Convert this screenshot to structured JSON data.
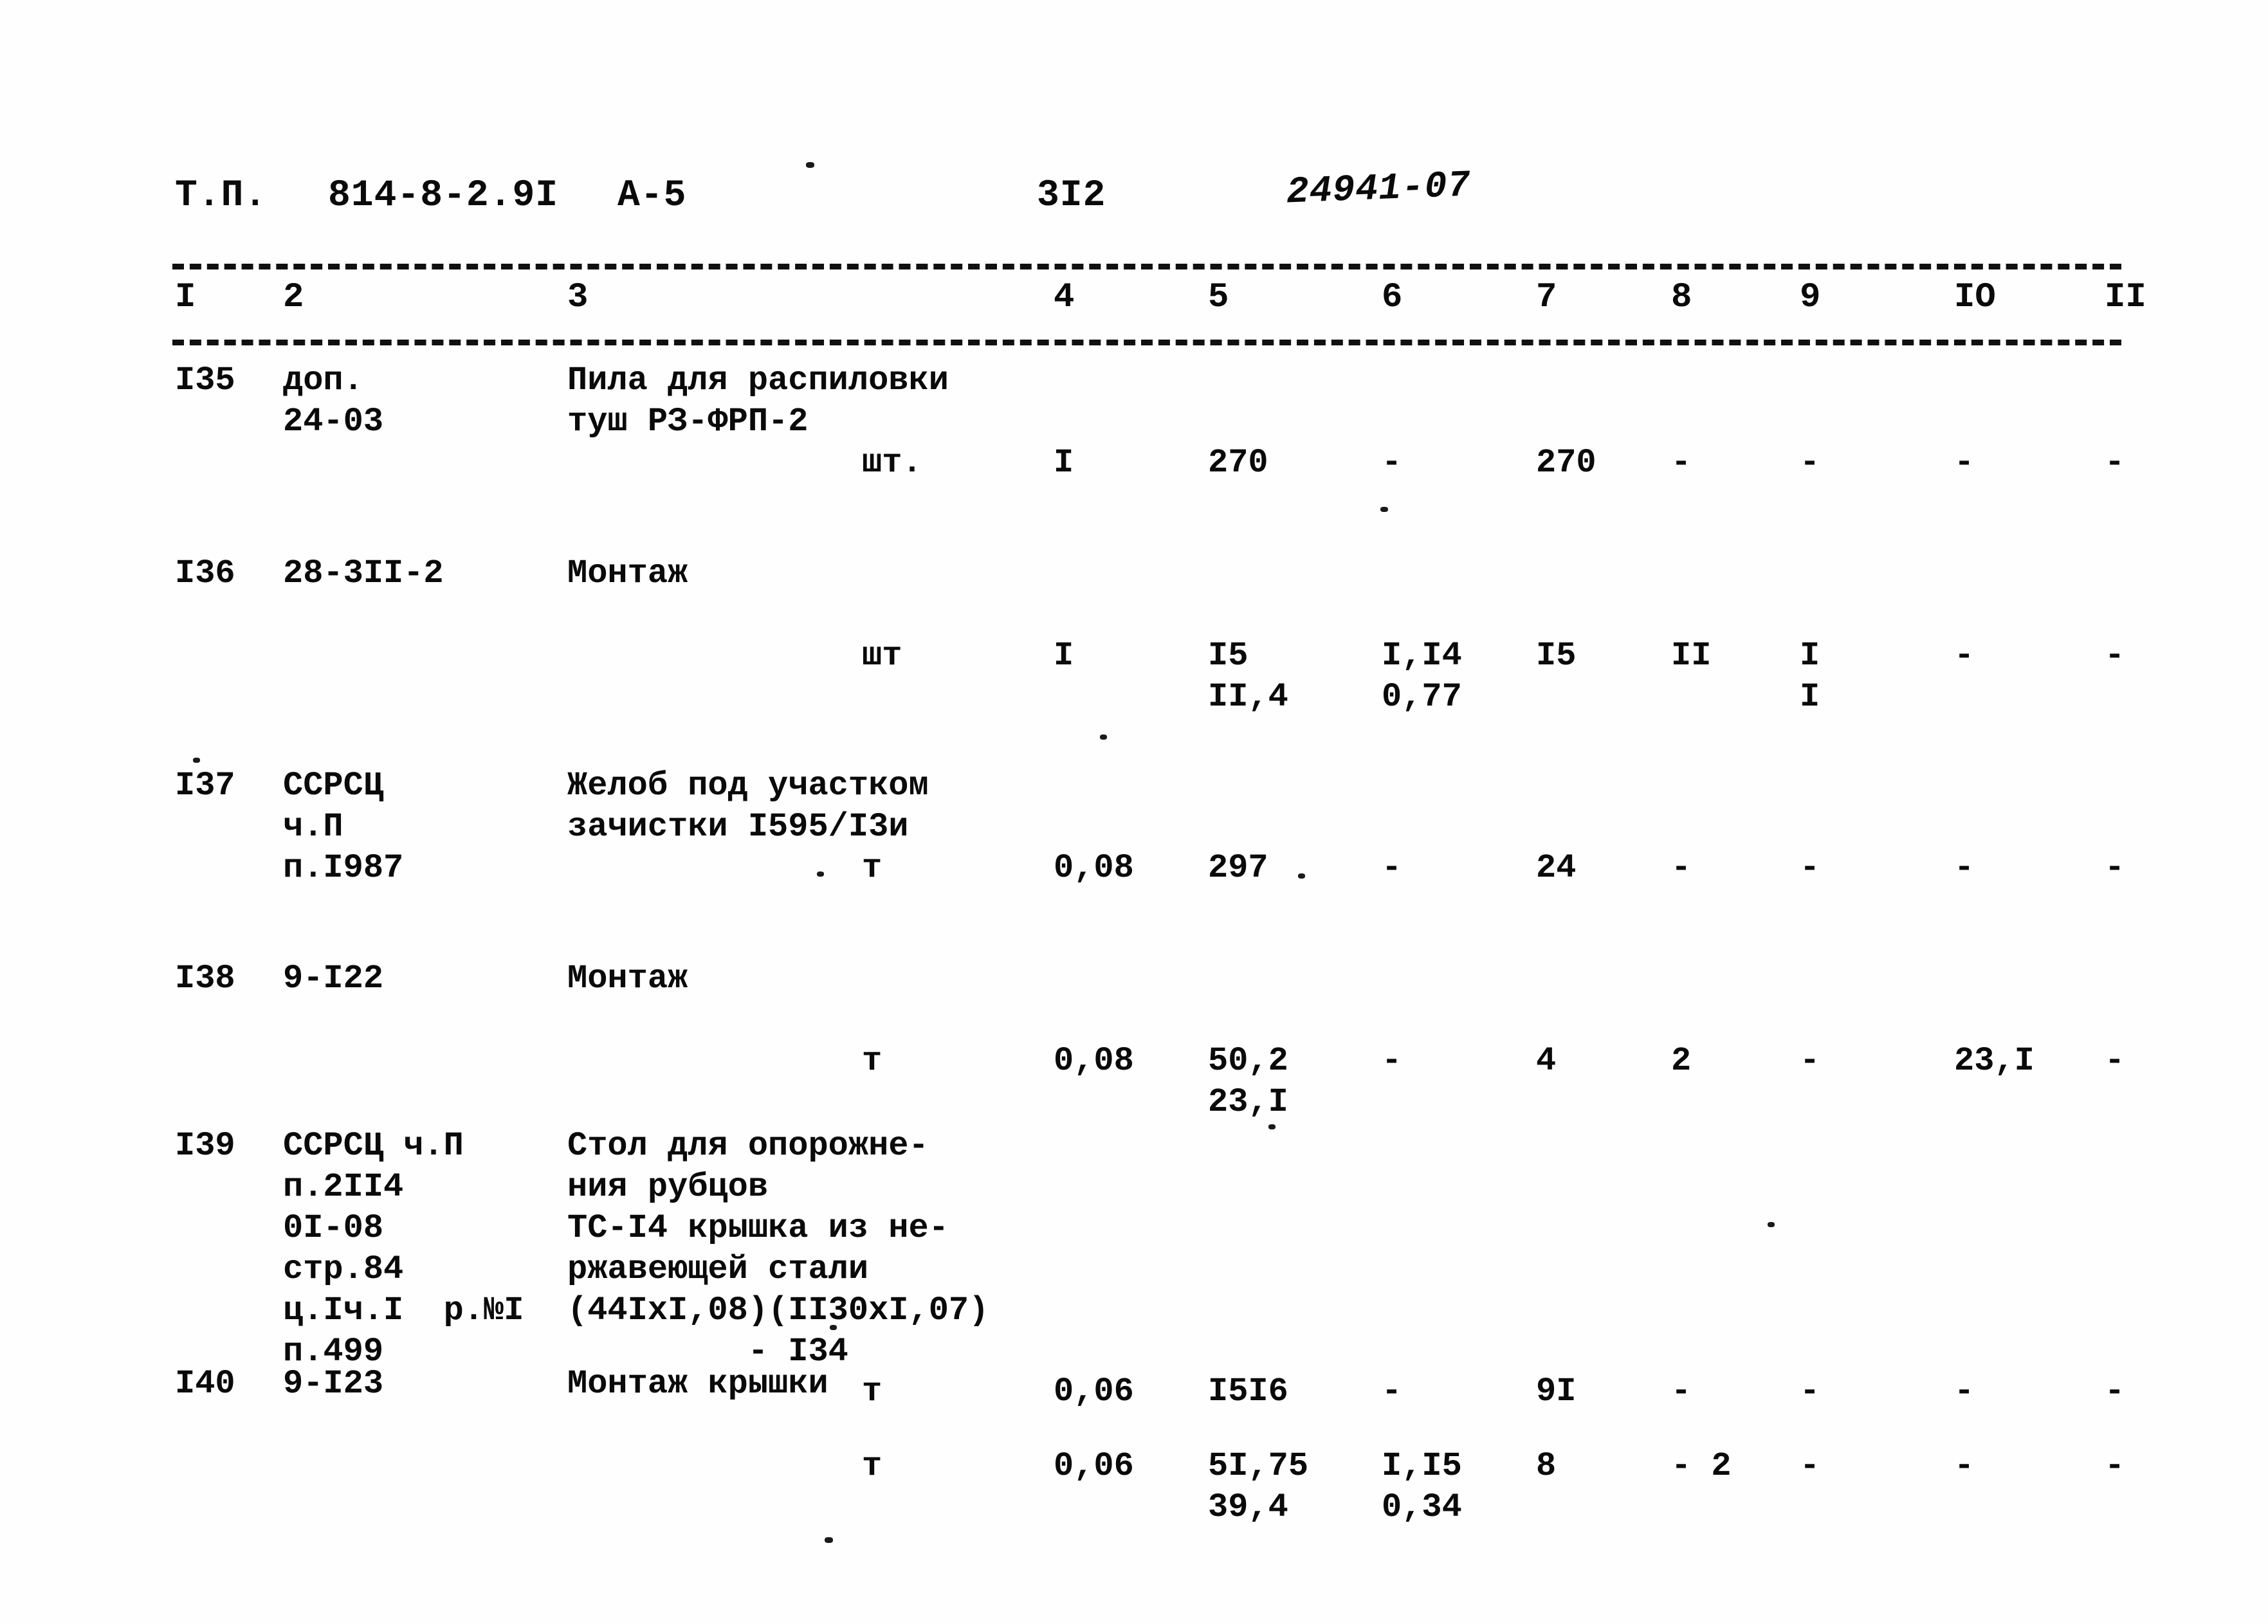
{
  "header": {
    "doc_type": "Т.П.",
    "doc_code": "814-8-2.9I",
    "sheet_code": "А-5",
    "page_number": "3I2",
    "stamp": "24941-07"
  },
  "table": {
    "column_headers": [
      "I",
      "2",
      "3",
      "4",
      "5",
      "6",
      "7",
      "8",
      "9",
      "IO",
      "II"
    ],
    "rows": [
      {
        "num": "I35",
        "ref": [
          "доп.",
          "24-03"
        ],
        "description": [
          "Пила для распиловки",
          "туш РЗ-ФРП-2"
        ],
        "unit": "шт.",
        "qty": "I",
        "c5": [
          "270"
        ],
        "c6": [
          "-"
        ],
        "c7": [
          "270"
        ],
        "c8": [
          "-"
        ],
        "c9": [
          "-"
        ],
        "c10": [
          "-"
        ],
        "c11": [
          "-"
        ]
      },
      {
        "num": "I36",
        "ref": [
          "28-3II-2"
        ],
        "description": [
          "Монтаж"
        ],
        "unit": "шт",
        "qty": "I",
        "c5": [
          "I5",
          "II,4"
        ],
        "c6": [
          "I,I4",
          "0,77"
        ],
        "c7": [
          "I5"
        ],
        "c8": [
          "II"
        ],
        "c9": [
          "I",
          "I"
        ],
        "c10": [
          "-"
        ],
        "c11": [
          "-"
        ]
      },
      {
        "num": "I37",
        "ref": [
          "ССРСЦ",
          "ч.П",
          "п.I987"
        ],
        "description": [
          "Желоб под участком",
          "зачистки I595/I3и"
        ],
        "unit": "т",
        "qty": "0,08",
        "c5": [
          "297"
        ],
        "c6": [
          "-"
        ],
        "c7": [
          "24"
        ],
        "c8": [
          "-"
        ],
        "c9": [
          "-"
        ],
        "c10": [
          "-"
        ],
        "c11": [
          "-"
        ]
      },
      {
        "num": "I38",
        "ref": [
          "9-I22"
        ],
        "description": [
          "Монтаж"
        ],
        "unit": "т",
        "qty": "0,08",
        "c5": [
          "50,2",
          "23,I"
        ],
        "c6": [
          "-"
        ],
        "c7": [
          "4"
        ],
        "c8": [
          "2"
        ],
        "c9": [
          "-"
        ],
        "c10": [
          "23,I"
        ],
        "c11": [
          "-"
        ]
      },
      {
        "num": "I39",
        "ref": [
          "ССРСЦ ч.П",
          "п.2II4",
          "0I-08",
          "стр.84",
          "ц.Iч.I  р.№I",
          "п.499"
        ],
        "description": [
          "Стол для опорожне-",
          "ния рубцов",
          "ТС-I4 крышка из не-",
          "ржавеющей стали",
          "(44IxI,08)(II30xI,07)",
          "         - I34"
        ],
        "unit": "т",
        "qty": "0,06",
        "c5": [
          "I5I6"
        ],
        "c6": [
          "-"
        ],
        "c7": [
          "9I"
        ],
        "c8": [
          "-"
        ],
        "c9": [
          "-"
        ],
        "c10": [
          "-"
        ],
        "c11": [
          "-"
        ]
      },
      {
        "num": "I40",
        "ref": [
          "9-I23"
        ],
        "description": [
          "Монтаж крышки"
        ],
        "unit": "т",
        "qty": "0,06",
        "c5": [
          "5I,75",
          "39,4"
        ],
        "c6": [
          "I,I5",
          "0,34"
        ],
        "c7": [
          "8"
        ],
        "c8": [
          "- 2"
        ],
        "c9": [
          "-"
        ],
        "c10": [
          "-"
        ],
        "c11": [
          "-"
        ]
      }
    ]
  }
}
